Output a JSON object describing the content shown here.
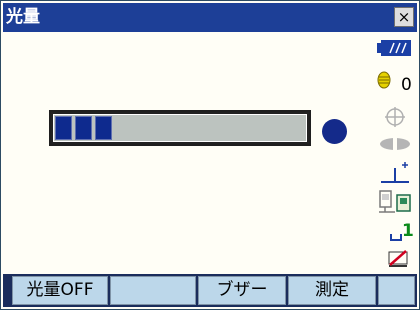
{
  "window": {
    "title": "光量",
    "close_label": "×"
  },
  "meter": {
    "segments_filled": 3
  },
  "status_panel": {
    "icons": [
      "battery-icon",
      "target-icon",
      "crosshair-icon",
      "prism-icon",
      "tilt-icon",
      "communication-icon",
      "prism-constant-icon",
      "edit-icon"
    ],
    "target_count": "0",
    "prism_constant_value": "1"
  },
  "softkeys": [
    "光量OFF",
    "",
    "ブザー",
    "測定",
    ""
  ],
  "colors": {
    "title_bar": "#1d3f97",
    "softkey_bg": "#bcd7ea",
    "meter_fill": "#0e2a8e",
    "status_dot": "#142a8a"
  }
}
